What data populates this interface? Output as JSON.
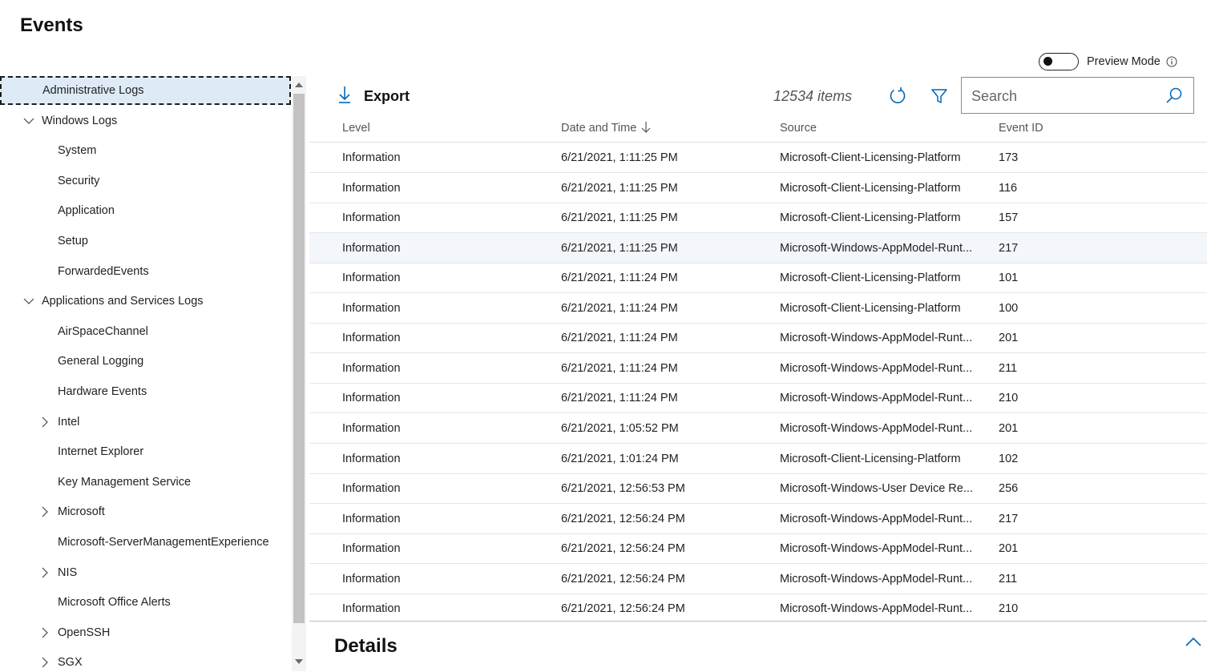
{
  "page": {
    "title": "Events"
  },
  "tree": {
    "items": [
      {
        "label": "Administrative Logs",
        "level": 1,
        "expander": "none",
        "selected": true
      },
      {
        "label": "Windows Logs",
        "level": 1,
        "expander": "expanded"
      },
      {
        "label": "System",
        "level": 2,
        "expander": "none"
      },
      {
        "label": "Security",
        "level": 2,
        "expander": "none"
      },
      {
        "label": "Application",
        "level": 2,
        "expander": "none"
      },
      {
        "label": "Setup",
        "level": 2,
        "expander": "none"
      },
      {
        "label": "ForwardedEvents",
        "level": 2,
        "expander": "none"
      },
      {
        "label": "Applications and Services Logs",
        "level": 1,
        "expander": "expanded"
      },
      {
        "label": "AirSpaceChannel",
        "level": 2,
        "expander": "none"
      },
      {
        "label": "General Logging",
        "level": 2,
        "expander": "none"
      },
      {
        "label": "Hardware Events",
        "level": 2,
        "expander": "none"
      },
      {
        "label": "Intel",
        "level": 2,
        "expander": "collapsed"
      },
      {
        "label": "Internet Explorer",
        "level": 2,
        "expander": "none"
      },
      {
        "label": "Key Management Service",
        "level": 2,
        "expander": "none"
      },
      {
        "label": "Microsoft",
        "level": 2,
        "expander": "collapsed"
      },
      {
        "label": "Microsoft-ServerManagementExperience",
        "level": 2,
        "expander": "none"
      },
      {
        "label": "NIS",
        "level": 2,
        "expander": "collapsed"
      },
      {
        "label": "Microsoft Office Alerts",
        "level": 2,
        "expander": "none"
      },
      {
        "label": "OpenSSH",
        "level": 2,
        "expander": "collapsed"
      },
      {
        "label": "SGX",
        "level": 2,
        "expander": "collapsed"
      }
    ]
  },
  "toolbar": {
    "preview_mode_label": "Preview Mode",
    "preview_mode_on": false,
    "export_label": "Export",
    "items_count": "12534 items",
    "search_placeholder": "Search"
  },
  "grid": {
    "columns": [
      {
        "key": "level",
        "label": "Level"
      },
      {
        "key": "datetime",
        "label": "Date and Time",
        "sorted": "descending"
      },
      {
        "key": "source",
        "label": "Source"
      },
      {
        "key": "event_id",
        "label": "Event ID"
      }
    ],
    "rows": [
      {
        "level": "Information",
        "datetime": "6/21/2021, 1:11:25 PM",
        "source": "Microsoft-Client-Licensing-Platform",
        "event_id": "173"
      },
      {
        "level": "Information",
        "datetime": "6/21/2021, 1:11:25 PM",
        "source": "Microsoft-Client-Licensing-Platform",
        "event_id": "116"
      },
      {
        "level": "Information",
        "datetime": "6/21/2021, 1:11:25 PM",
        "source": "Microsoft-Client-Licensing-Platform",
        "event_id": "157"
      },
      {
        "level": "Information",
        "datetime": "6/21/2021, 1:11:25 PM",
        "source": "Microsoft-Windows-AppModel-Runt...",
        "event_id": "217",
        "hover": true
      },
      {
        "level": "Information",
        "datetime": "6/21/2021, 1:11:24 PM",
        "source": "Microsoft-Client-Licensing-Platform",
        "event_id": "101"
      },
      {
        "level": "Information",
        "datetime": "6/21/2021, 1:11:24 PM",
        "source": "Microsoft-Client-Licensing-Platform",
        "event_id": "100"
      },
      {
        "level": "Information",
        "datetime": "6/21/2021, 1:11:24 PM",
        "source": "Microsoft-Windows-AppModel-Runt...",
        "event_id": "201"
      },
      {
        "level": "Information",
        "datetime": "6/21/2021, 1:11:24 PM",
        "source": "Microsoft-Windows-AppModel-Runt...",
        "event_id": "211"
      },
      {
        "level": "Information",
        "datetime": "6/21/2021, 1:11:24 PM",
        "source": "Microsoft-Windows-AppModel-Runt...",
        "event_id": "210"
      },
      {
        "level": "Information",
        "datetime": "6/21/2021, 1:05:52 PM",
        "source": "Microsoft-Windows-AppModel-Runt...",
        "event_id": "201"
      },
      {
        "level": "Information",
        "datetime": "6/21/2021, 1:01:24 PM",
        "source": "Microsoft-Client-Licensing-Platform",
        "event_id": "102"
      },
      {
        "level": "Information",
        "datetime": "6/21/2021, 12:56:53 PM",
        "source": "Microsoft-Windows-User Device Re...",
        "event_id": "256"
      },
      {
        "level": "Information",
        "datetime": "6/21/2021, 12:56:24 PM",
        "source": "Microsoft-Windows-AppModel-Runt...",
        "event_id": "217"
      },
      {
        "level": "Information",
        "datetime": "6/21/2021, 12:56:24 PM",
        "source": "Microsoft-Windows-AppModel-Runt...",
        "event_id": "201"
      },
      {
        "level": "Information",
        "datetime": "6/21/2021, 12:56:24 PM",
        "source": "Microsoft-Windows-AppModel-Runt...",
        "event_id": "211"
      },
      {
        "level": "Information",
        "datetime": "6/21/2021, 12:56:24 PM",
        "source": "Microsoft-Windows-AppModel-Runt...",
        "event_id": "210"
      }
    ]
  },
  "details": {
    "title": "Details"
  },
  "icons": {
    "export": "download-arrow-icon",
    "refresh": "refresh-icon",
    "filter": "filter-icon",
    "search": "search-icon",
    "info": "info-icon",
    "collapse": "chevron-up-icon",
    "sort": "arrow-down-icon"
  },
  "colors": {
    "selected_bg": "#deebf6",
    "hover_row_bg": "#f3f6fa",
    "accent": "#0067b8"
  }
}
